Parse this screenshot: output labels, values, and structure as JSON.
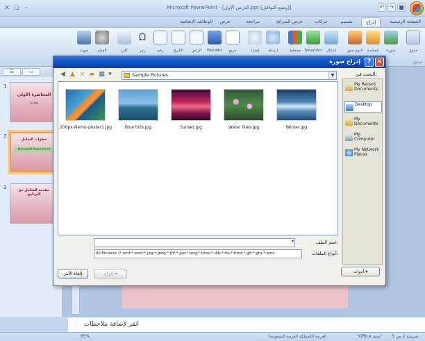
{
  "window": {
    "title": "Microsoft PowerPoint - [الدرس الاول.ppt [وضع التوافق]]",
    "qat_icons": [
      "save-icon",
      "undo-icon",
      "redo-icon"
    ]
  },
  "ribbon": {
    "tabs": [
      "الصفحة الرئيسية",
      "إدراج",
      "تصميم",
      "حركات",
      "عرض الشرائح",
      "مراجعة",
      "عرض",
      "الوظائف الإضافية"
    ],
    "active_tab": "إدراج",
    "buttons": [
      "جدول",
      "صورة",
      "قصاصة",
      "ألبوم صور",
      "أشكال",
      "SmartArt",
      "مخطط",
      "ارتباط",
      "إجراء",
      "مربع",
      "WordArt",
      "الرأس",
      "التاريخ",
      "رقم",
      "رمز",
      "كائن",
      "الفيلم",
      "صوت"
    ],
    "group_label": "جداول"
  },
  "slides_pane": {
    "slides": [
      {
        "num": "1",
        "title": "المحاضرة الأولى",
        "subtitle": "مقدمة"
      },
      {
        "num": "2",
        "title": "خطوات التعامل",
        "subtitle": "Microsoft PowerPoint"
      },
      {
        "num": "3",
        "title": "مقدمة للتعامل مع البرنامج",
        "subtitle": ""
      }
    ]
  },
  "notes": {
    "placeholder": "انقر لإضافة ملاحظات"
  },
  "status": {
    "slide_info": "شريحة 2 من 3",
    "theme": "\"Office سمة\"",
    "lang": "العربية (المملكة العربية السعودية)",
    "zoom": "65%"
  },
  "dialog": {
    "title": "إدراج صورة",
    "look_in_label": "البحث في:",
    "look_in_value": "Sample Pictures",
    "places": [
      "My Recent Documents",
      "Desktop",
      "My Documents",
      "My Computer",
      "My Network Places"
    ],
    "files": [
      "200px-Nemo-poster1.jpg",
      "Blue hills.jpg",
      "Sunset.jpg",
      "Water lilies.jpg",
      "Winter.jpg"
    ],
    "file_name_label": "اسم الملف:",
    "file_name_value": "",
    "file_type_label": "أنواع الملفات:",
    "file_type_value": "All Pictures (*.emf;*.wmf;*.jpg;*.jpeg;*.jfif;*.jpe;*.png;*.bmp;*.dib;*.rle;*.bmz;*.gif;*.gfa;*.emz",
    "tools_label": "أدوات",
    "insert_label": "إدراج",
    "cancel_label": "إلغاء الأمر"
  },
  "colors": {
    "title_blue": "#0a4cc2",
    "selection_orange": "#f39b3a",
    "slide_pink": "#e9a9b6"
  }
}
